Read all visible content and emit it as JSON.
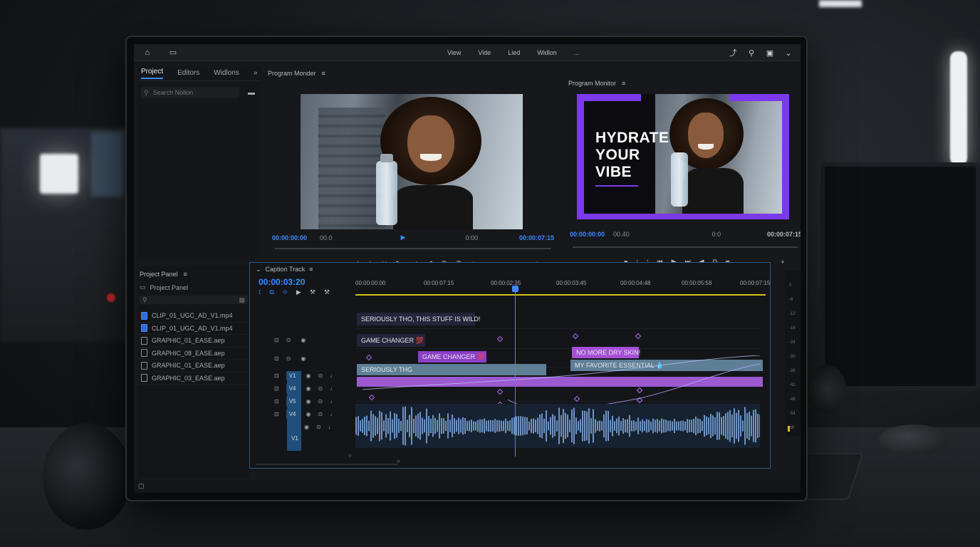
{
  "topbar": {
    "menu": [
      "View",
      "Vide",
      "Lied",
      "Widlon",
      "..."
    ]
  },
  "project_panel": {
    "tabs": [
      "Project",
      "Editors",
      "Widlons",
      "»"
    ],
    "search_placeholder": "Search Nolion"
  },
  "program_monitor_left": {
    "title": "Program Monder",
    "timecode_in": "00:00:00:00",
    "timecode_zoom": "00.0",
    "timecode_fit": "0:00",
    "timecode_out": "00:00:07:15"
  },
  "program_monitor_right": {
    "title": "Program Monitor",
    "timecode_in": "00:00:00:00",
    "timecode_zoom": "00.40",
    "timecode_fit": "0:0",
    "timecode_out": "00:00:07:15",
    "overlay_lines": [
      "HYDRATE",
      "YOUR",
      "VIBE"
    ],
    "accent_color": "#7c3aed"
  },
  "project_panel_bottom": {
    "title": "Project Panel",
    "folder": "Project Panel",
    "files": [
      {
        "name": "CLIP_01_UGC_AD_V1.mp4",
        "type": "video"
      },
      {
        "name": "CLIP_01_UGC_AD_V1.mp4",
        "type": "video"
      },
      {
        "name": "GRAPHIC_01_EASE.aep",
        "type": "graphic"
      },
      {
        "name": "GRAPHIC_08_EASE.aep",
        "type": "graphic"
      },
      {
        "name": "GRAPHIC_01_EASE.aep",
        "type": "graphic"
      },
      {
        "name": "GRAPHIC_03_EASE.aep",
        "type": "graphic"
      }
    ]
  },
  "timeline": {
    "title": "Caption Track",
    "timecode": "00:00:03:20",
    "ruler": [
      "00:00:00:00",
      "00:00:07:15",
      "00:00:02:35",
      "00:00:03:45",
      "00:00:04:48",
      "00:00:05:58",
      "00:00:07:15"
    ],
    "tracks": [
      "V1",
      "V4",
      "V5",
      "V4",
      "V1"
    ],
    "captions": {
      "c1": "SERIOUSLY THO, THIS STUFF IS WILD!",
      "c2": "GAME CHANGER 💯",
      "c3": "GAME CHANGER 💯",
      "c4": "NO MORE DRY SKIN!",
      "c5": "SERIOUSLY THG",
      "c6": "MY FAVORITE ESSENTIAL 💧"
    },
    "meter_labels": [
      "0",
      "-6",
      "-12",
      "-18",
      "-24",
      "-30",
      "-36",
      "-42",
      "-48",
      "-54",
      "dB"
    ]
  }
}
